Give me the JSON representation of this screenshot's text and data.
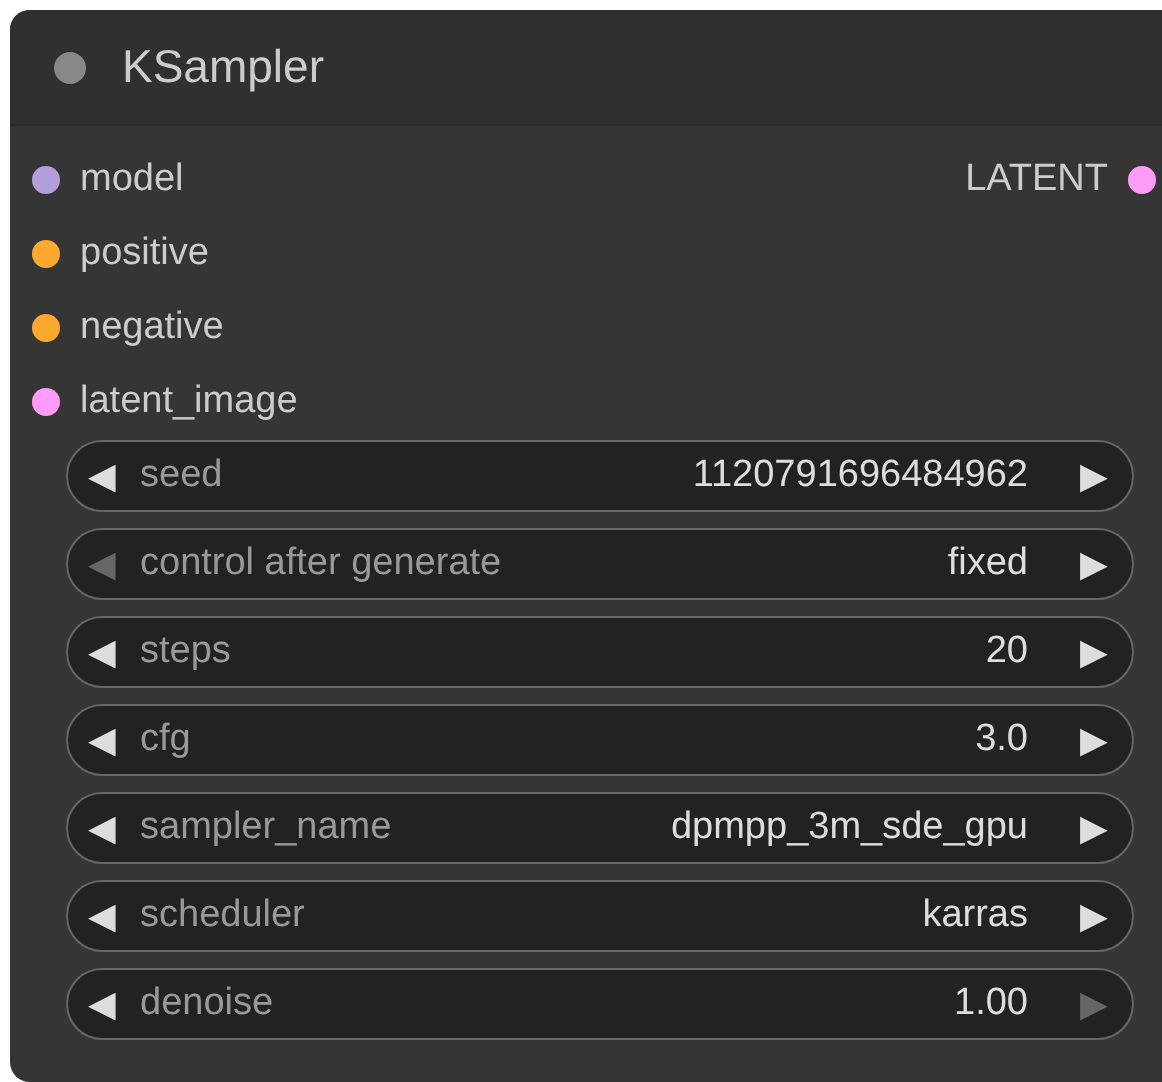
{
  "node": {
    "title": "KSampler"
  },
  "inputs": [
    {
      "label": "model",
      "color": "#b39ddb"
    },
    {
      "label": "positive",
      "color": "#ffa931"
    },
    {
      "label": "negative",
      "color": "#ffa931"
    },
    {
      "label": "latent_image",
      "color": "#ff9cf9"
    }
  ],
  "outputs": [
    {
      "label": "LATENT",
      "color": "#ff9cf9"
    }
  ],
  "widgets": [
    {
      "name": "seed",
      "value": "1120791696484962",
      "left_arrow": "◀",
      "right_arrow": "▶",
      "left_disabled": false,
      "right_disabled": false
    },
    {
      "name": "control after generate",
      "value": "fixed",
      "left_arrow": "◀",
      "right_arrow": "▶",
      "left_disabled": true,
      "right_disabled": false
    },
    {
      "name": "steps",
      "value": "20",
      "left_arrow": "◀",
      "right_arrow": "▶",
      "left_disabled": false,
      "right_disabled": false
    },
    {
      "name": "cfg",
      "value": "3.0",
      "left_arrow": "◀",
      "right_arrow": "▶",
      "left_disabled": false,
      "right_disabled": false
    },
    {
      "name": "sampler_name",
      "value": "dpmpp_3m_sde_gpu",
      "left_arrow": "◀",
      "right_arrow": "▶",
      "left_disabled": false,
      "right_disabled": false
    },
    {
      "name": "scheduler",
      "value": "karras",
      "left_arrow": "◀",
      "right_arrow": "▶",
      "left_disabled": false,
      "right_disabled": false
    },
    {
      "name": "denoise",
      "value": "1.00",
      "left_arrow": "◀",
      "right_arrow": "▶",
      "left_disabled": false,
      "right_disabled": true
    }
  ]
}
